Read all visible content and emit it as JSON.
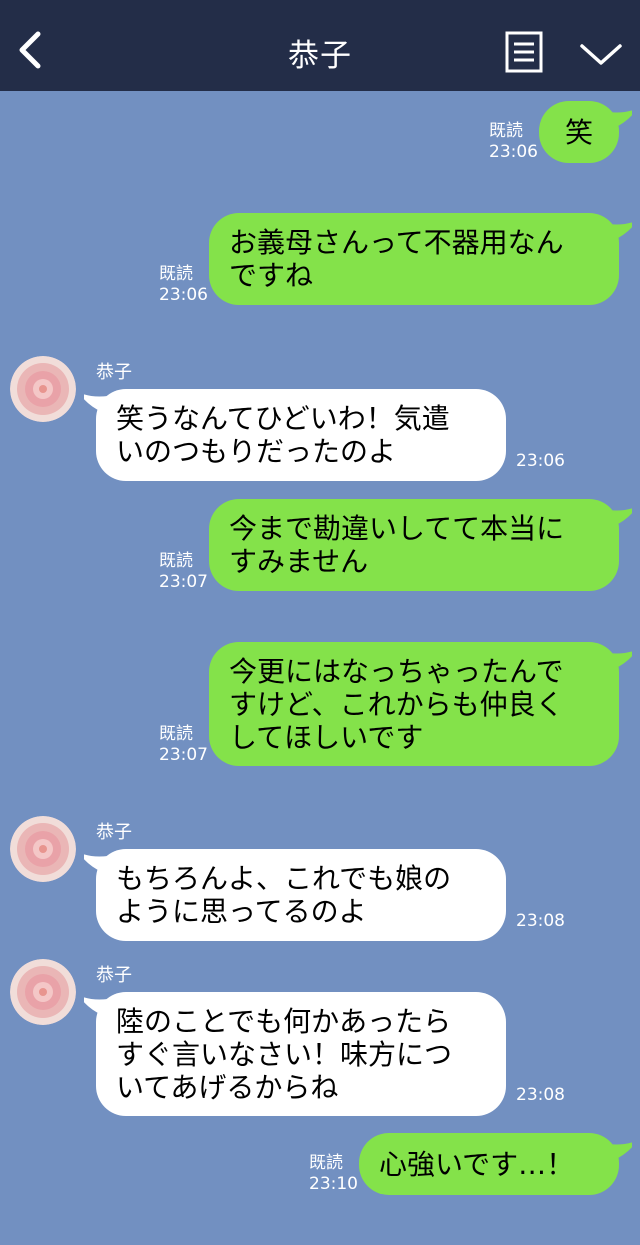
{
  "header": {
    "title": "恭子",
    "back_icon": "chevron-left-icon",
    "menu_icon": "notes-icon",
    "chevron_icon": "chevron-down-icon"
  },
  "colors": {
    "background": "#7290c1",
    "header": "#232d48",
    "outgoing_bubble": "#84e24a",
    "incoming_bubble": "#ffffff"
  },
  "messages": [
    {
      "direction": "out",
      "text": "笑",
      "read": "既読",
      "time": "23:06"
    },
    {
      "direction": "out",
      "text": "お義母さんって不器用なん\nですね",
      "read": "既読",
      "time": "23:06"
    },
    {
      "direction": "in",
      "sender": "恭子",
      "text": "笑うなんてひどいわ！気遣\nいのつもりだったのよ",
      "time": "23:06"
    },
    {
      "direction": "out",
      "text": "今まで勘違いしてて本当に\nすみません",
      "read": "既読",
      "time": "23:07"
    },
    {
      "direction": "out",
      "text": "今更にはなっちゃったんで\nすけど、これからも仲良く\nしてほしいです",
      "read": "既読",
      "time": "23:07"
    },
    {
      "direction": "in",
      "sender": "恭子",
      "text": "もちろんよ、これでも娘の\nように思ってるのよ",
      "time": "23:08"
    },
    {
      "direction": "in",
      "sender": "恭子",
      "text": "陸のことでも何かあったら\nすぐ言いなさい！味方につ\nいてあげるからね",
      "time": "23:08"
    },
    {
      "direction": "out",
      "text": "心強いです…！",
      "read": "既読",
      "time": "23:10"
    }
  ]
}
